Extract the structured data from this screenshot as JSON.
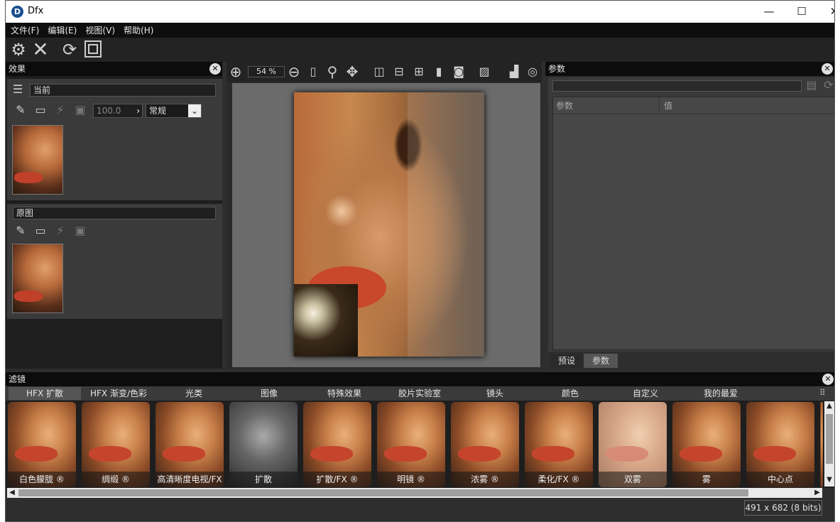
{
  "window": {
    "title": "Dfx",
    "icon": "dfx-logo-icon"
  },
  "window_buttons": {
    "minimize": "—",
    "maximize": "☐",
    "close": "✕"
  },
  "menu": [
    "文件(F)",
    "编辑(E)",
    "视图(V)",
    "帮助(H)"
  ],
  "toolbar": {
    "icons": [
      "gear-icon",
      "close-x-icon",
      "refresh-icon",
      "fit-frame-icon"
    ]
  },
  "effects_panel": {
    "title": "效果",
    "current_label": "当前",
    "opacity_value": "100.0",
    "blend_mode": "常规",
    "original_label": "原图"
  },
  "viewer": {
    "zoom": "54 %",
    "tools": [
      "zoom-in-icon",
      "zoom-out-icon",
      "fit-height-icon",
      "magnifier-icon",
      "pan-icon",
      "split-vertical-icon",
      "split-half-icon",
      "split-horizontal-icon",
      "page-icon",
      "camera-icon",
      "image-icon",
      "histogram-icon",
      "loupe-icon"
    ]
  },
  "params_panel": {
    "title": "参数",
    "col_param": "参数",
    "col_value": "值",
    "tab_presets": "预设",
    "tab_params": "参数"
  },
  "filters_panel": {
    "title": "滤镜",
    "tabs": [
      "HFX 扩散",
      "HFX 渐变/色彩",
      "光类",
      "图像",
      "特殊效果",
      "胶片实验室",
      "镜头",
      "颜色",
      "自定义",
      "我的最爱"
    ],
    "thumbnails": [
      "白色朦胧 ®",
      "绸缎 ®",
      "高清晰度电视/FX",
      "扩散",
      "扩散/FX ®",
      "明镜 ®",
      "浓雾 ®",
      "柔化/FX ®",
      "双雾",
      "雾",
      "中心点"
    ]
  },
  "status": {
    "image_info": "491 x 682 (8 bits)"
  },
  "colors": {
    "panel_bg": "#2e2e2e",
    "header_bg": "#0c0c0c",
    "viewer_bg": "#6b6b6b",
    "accent_tab": "#555555"
  }
}
